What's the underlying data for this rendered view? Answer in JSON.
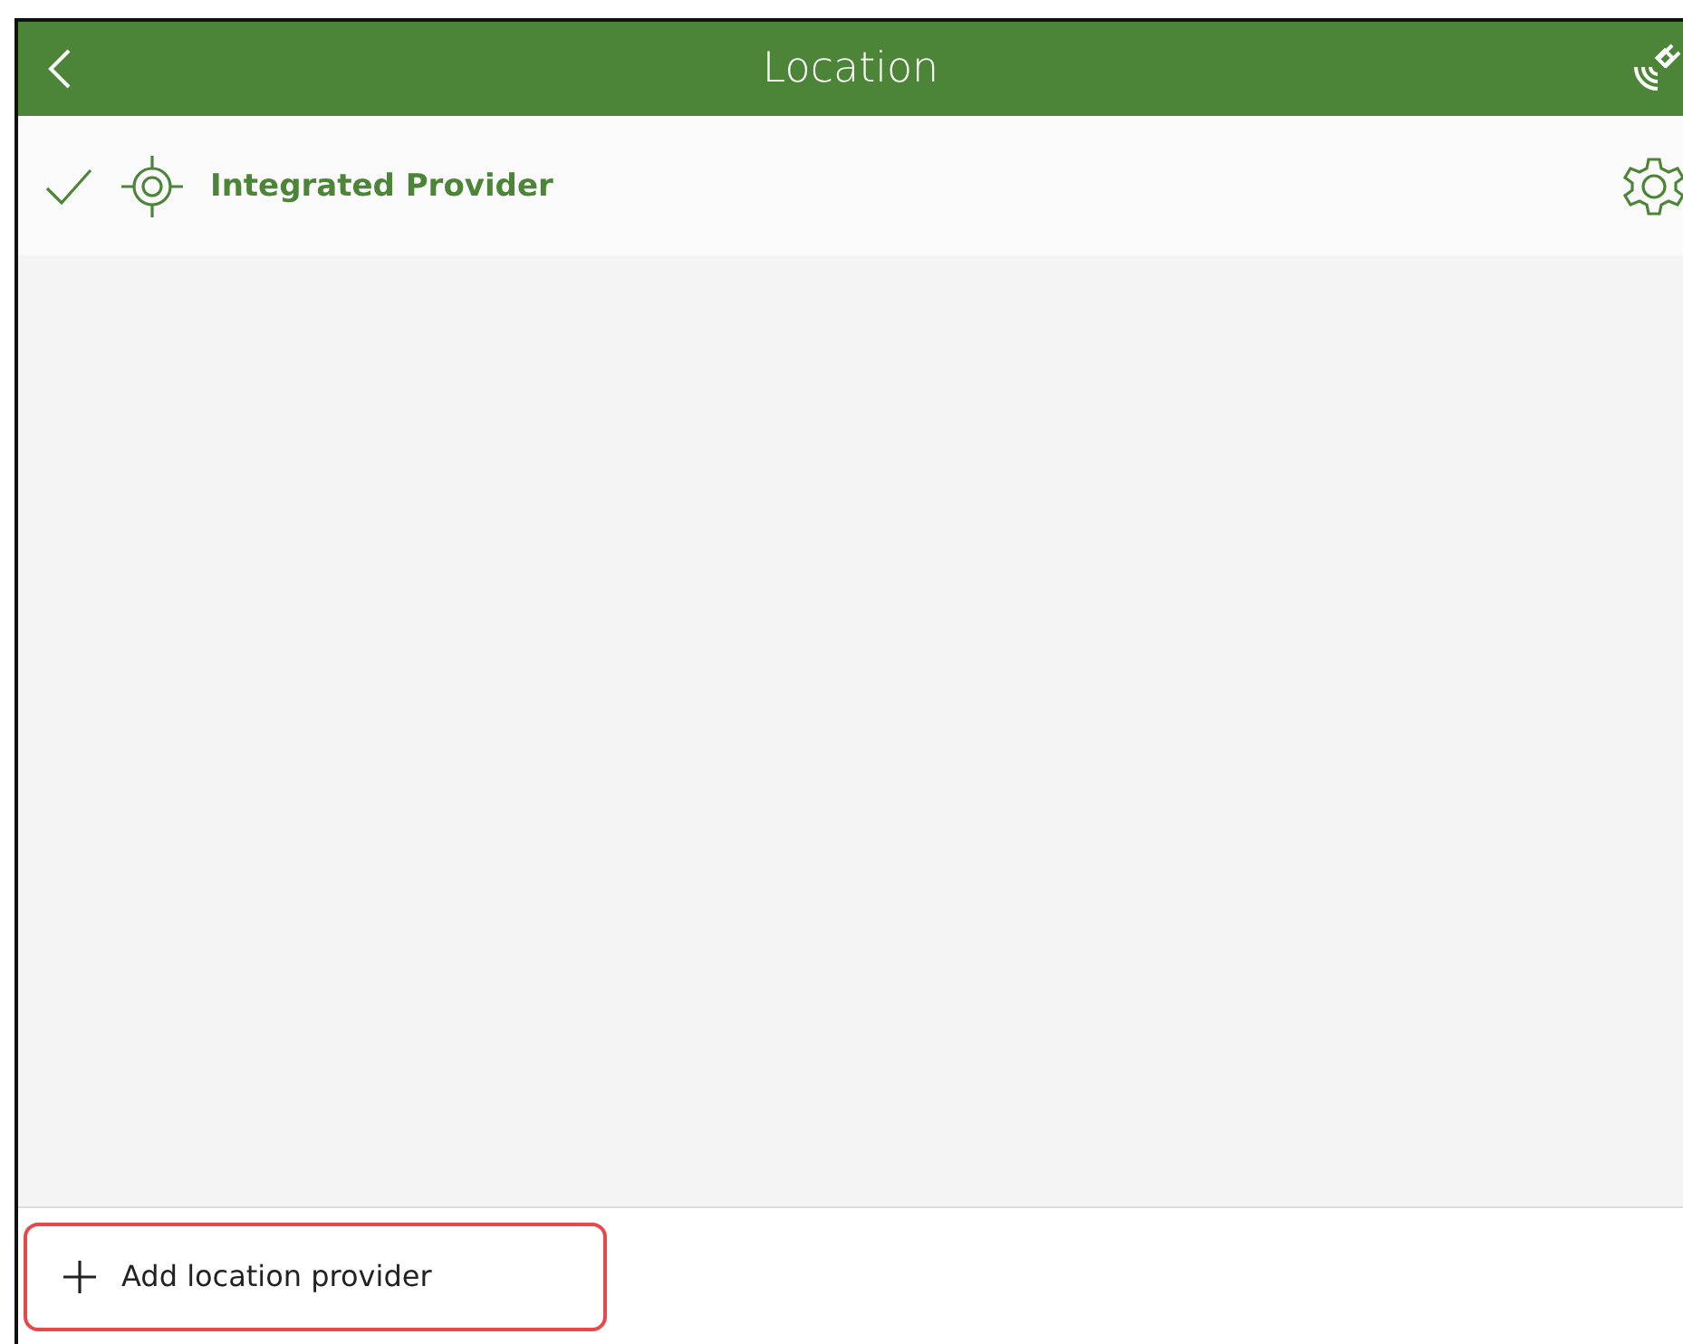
{
  "header": {
    "title": "Location"
  },
  "providers": [
    {
      "name": "Integrated Provider",
      "selected": true
    }
  ],
  "add_button": {
    "label": "Add location provider",
    "highlighted": true
  }
}
